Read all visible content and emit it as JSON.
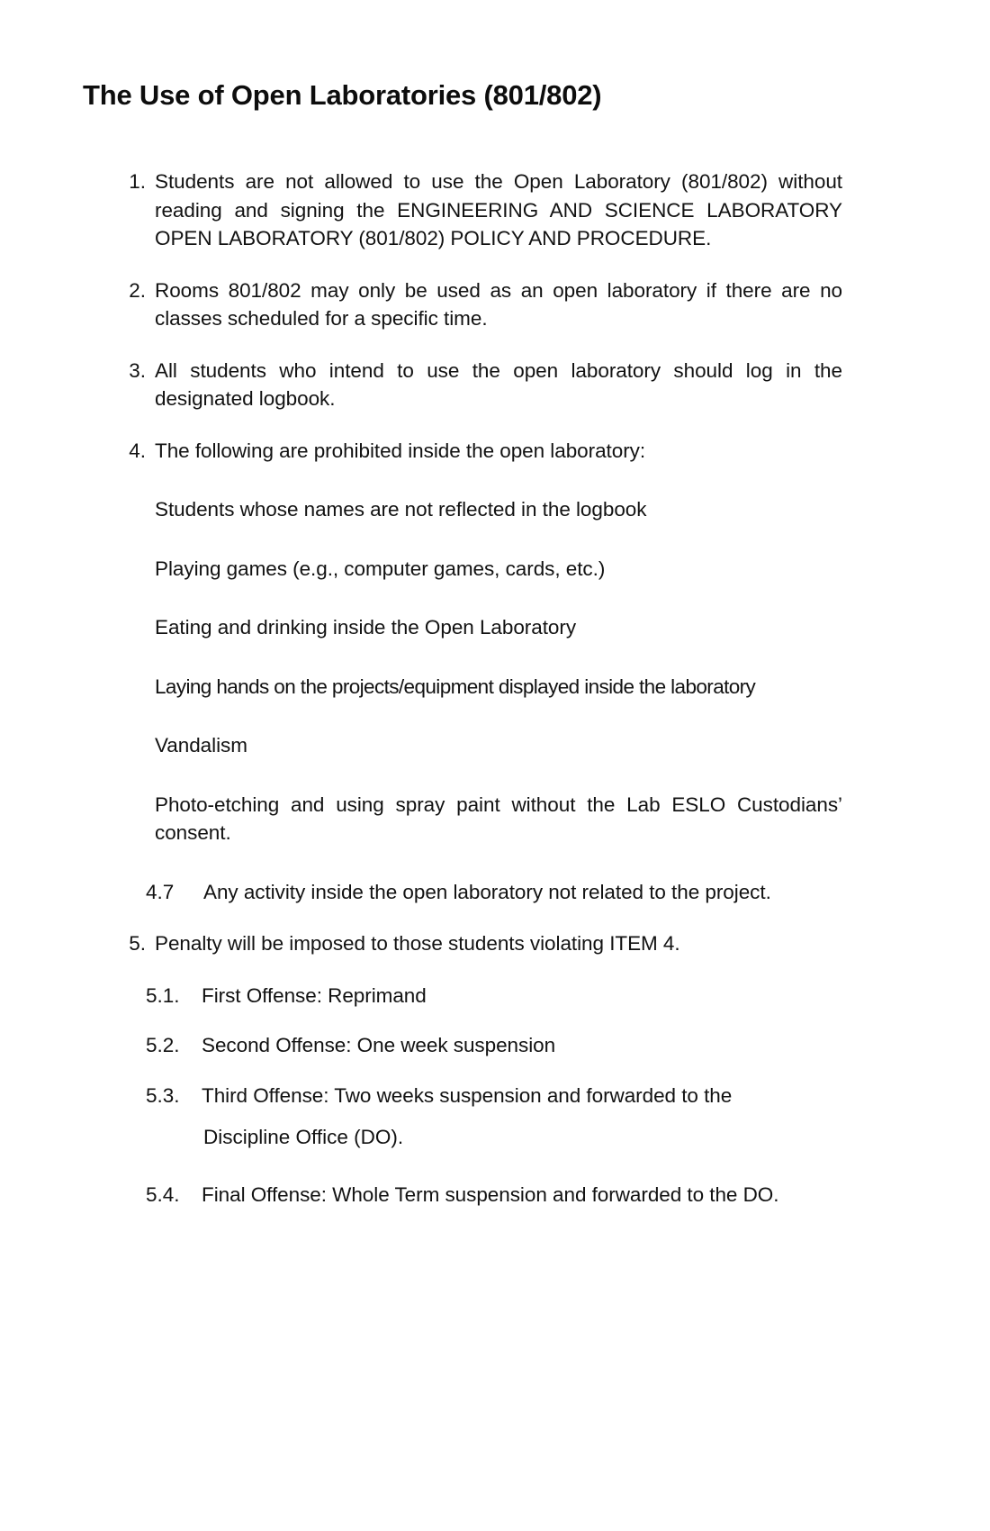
{
  "document": {
    "title": "The Use of Open Laboratories (801/802)",
    "items": [
      {
        "number": "1.",
        "text": "Students are not allowed to use the Open Laboratory (801/802) without reading and signing the ENGINEERING AND SCIENCE LABORATORY OPEN LABORATORY (801/802) POLICY AND PROCEDURE."
      },
      {
        "number": "2.",
        "text": "Rooms 801/802 may only be used as an open laboratory if there are no classes scheduled for a specific time."
      },
      {
        "number": "3.",
        "text": "All students who intend to use the open laboratory should log in the designated logbook."
      },
      {
        "number": "4.",
        "text": "The following are prohibited inside the open laboratory:"
      }
    ],
    "prohibited": [
      "Students whose names are not reflected in the logbook",
      "Playing games (e.g., computer games, cards, etc.)",
      "Eating and drinking inside the Open Laboratory",
      "Laying hands on the projects/equipment displayed inside the laboratory",
      "Vandalism",
      "Photo-etching and using spray paint without the Lab ESLO Custodians’ consent."
    ],
    "prohibited_last": {
      "number": "4.7",
      "text": "Any activity inside the open laboratory not related to the project."
    },
    "penalty_item": {
      "number": "5.",
      "text": "Penalty will be imposed to those students violating ITEM 4."
    },
    "penalties": [
      {
        "number": "5.1.",
        "text": "First Offense: Reprimand"
      },
      {
        "number": "5.2.",
        "text": "Second Offense: One week suspension"
      },
      {
        "number": "5.3.",
        "text": "Third Offense: Two weeks suspension and forwarded to the",
        "continuation": "Discipline Office (DO)."
      },
      {
        "number": "5.4.",
        "text": "Final Offense: Whole Term suspension and forwarded to the DO."
      }
    ]
  }
}
